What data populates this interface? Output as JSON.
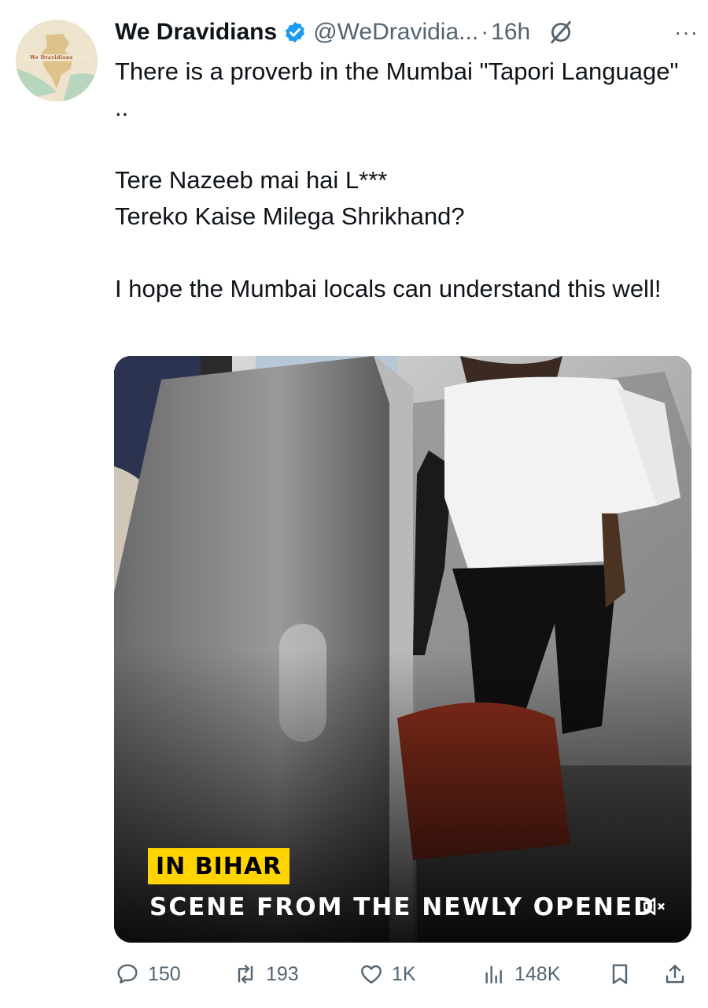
{
  "tweet": {
    "author_name": "We Dravidians",
    "handle": "@WeDravidia...",
    "separator": "·",
    "time": "16h",
    "more": "···",
    "avatar_text": "We Dravidians",
    "paragraphs": [
      "There is a proverb in the Mumbai \"Tapori Language\" ..",
      "Tere Nazeeb mai hai L***\nTereko Kaise Milega Shrikhand?",
      "I hope the Mumbai locals can understand this well!"
    ]
  },
  "media": {
    "caption_tag": "IN BIHAR",
    "caption_line": "SCENE FROM THE NEWLY OPENED"
  },
  "actions": {
    "replies": "150",
    "reposts": "193",
    "likes": "1K",
    "views": "148K"
  },
  "colors": {
    "verified": "#1d9bf0",
    "muted_text": "#536471",
    "caption_tag_bg": "#ffd400"
  },
  "icons": [
    "verified-badge-icon",
    "grok-icon",
    "more-icon",
    "mute-icon",
    "reply-icon",
    "repost-icon",
    "like-icon",
    "views-icon",
    "bookmark-icon",
    "share-icon"
  ]
}
